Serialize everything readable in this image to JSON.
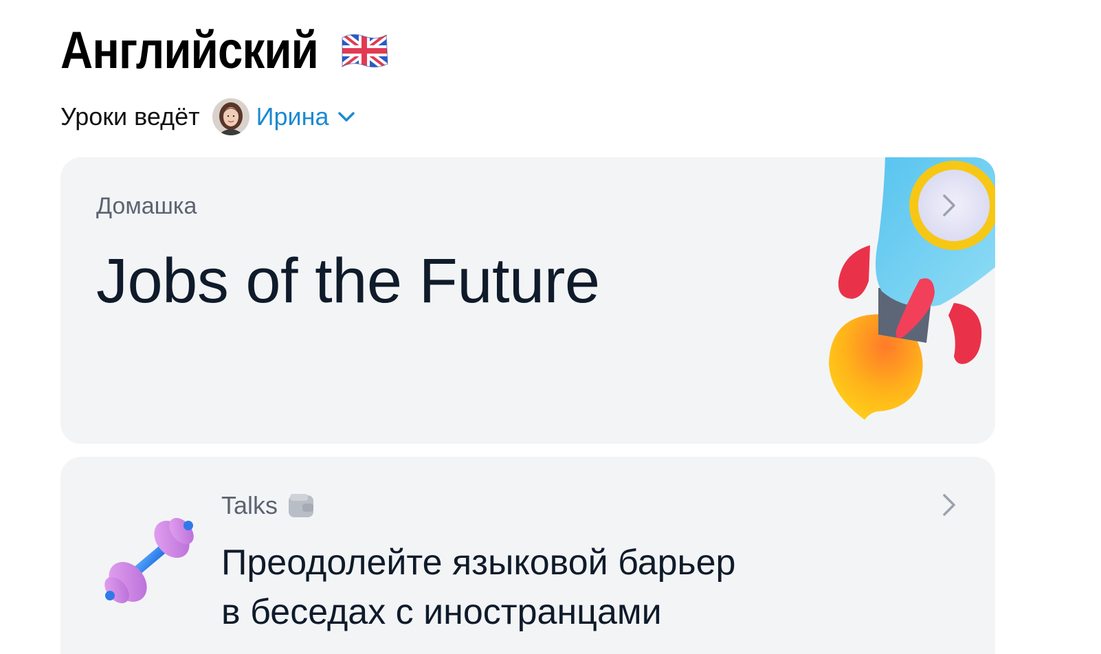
{
  "header": {
    "title": "Английский",
    "flag_icon": "uk-flag-icon",
    "teacher_prefix": "Уроки ведёт",
    "teacher_name": "Ирина",
    "teacher_dropdown_icon": "chevron-down-icon"
  },
  "homework_card": {
    "label": "Домашка",
    "title": "Jobs of the Future",
    "illustration": "rocket-icon",
    "arrow_icon": "chevron-right-icon"
  },
  "talks_card": {
    "label": "Talks",
    "label_icon": "wallet-icon",
    "title_line1": "Преодолейте языковой барьер",
    "title_line2": "в беседах с иностранцами",
    "illustration": "dumbbell-icon",
    "arrow_icon": "chevron-right-icon"
  },
  "colors": {
    "accent": "#1a8ad1",
    "card_bg": "#f3f4f6",
    "text_primary": "#0f1b2a",
    "text_secondary": "#5b6470"
  }
}
